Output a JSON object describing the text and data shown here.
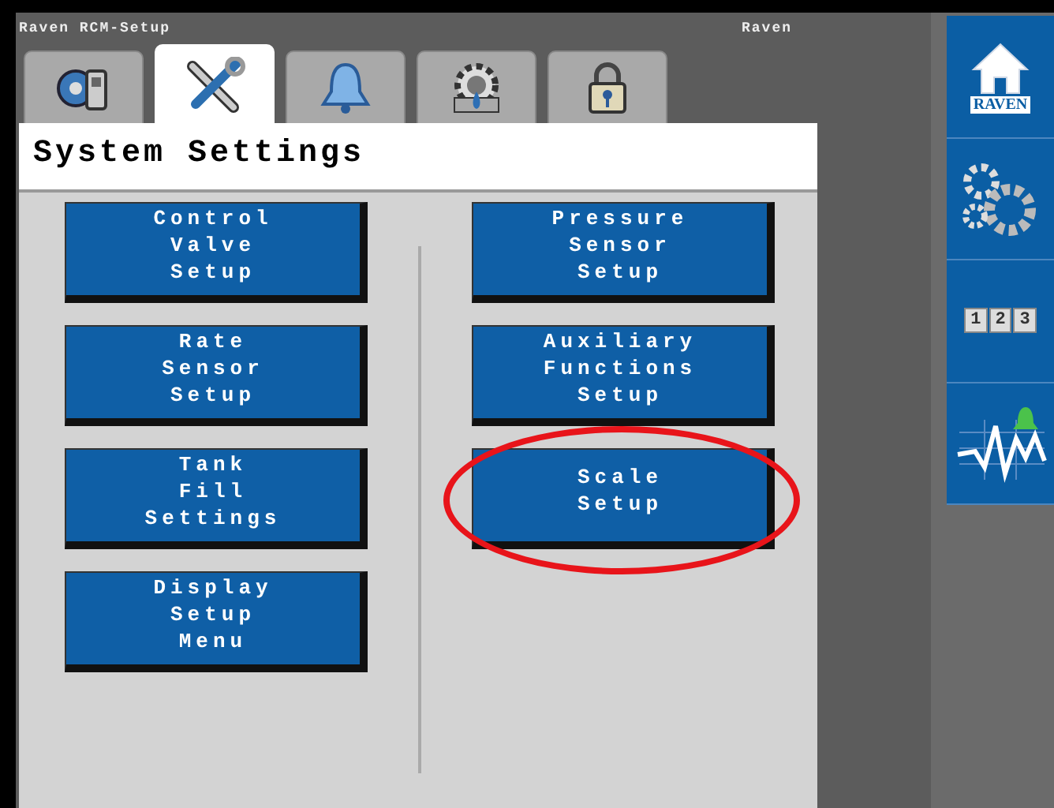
{
  "title_bar": {
    "app": "Raven RCM-Setup",
    "brand": "Raven"
  },
  "tabs": [
    {
      "kind": "machine",
      "selected": false
    },
    {
      "kind": "tools",
      "selected": true
    },
    {
      "kind": "alarm",
      "selected": false
    },
    {
      "kind": "product",
      "selected": false
    },
    {
      "kind": "lock",
      "selected": false
    }
  ],
  "header": "System Settings",
  "columns": [
    [
      {
        "lines": [
          "Control",
          "Valve",
          "Setup"
        ],
        "highlighted": false
      },
      {
        "lines": [
          "Rate",
          "Sensor",
          "Setup"
        ],
        "highlighted": false
      },
      {
        "lines": [
          "Tank",
          "Fill",
          "Settings"
        ],
        "highlighted": false
      },
      {
        "lines": [
          "Display",
          "Setup",
          "Menu"
        ],
        "highlighted": false
      }
    ],
    [
      {
        "lines": [
          "Pressure",
          "Sensor",
          "Setup"
        ],
        "highlighted": false
      },
      {
        "lines": [
          "Auxiliary",
          "Functions",
          "Setup"
        ],
        "highlighted": false
      },
      {
        "lines": [
          "Scale",
          "Setup"
        ],
        "highlighted": true
      }
    ]
  ],
  "sidebar": [
    {
      "kind": "home",
      "logo": "RAVEN"
    },
    {
      "kind": "settings"
    },
    {
      "kind": "keypad",
      "keys": [
        "1",
        "2",
        "3"
      ]
    },
    {
      "kind": "diagnostics"
    }
  ]
}
